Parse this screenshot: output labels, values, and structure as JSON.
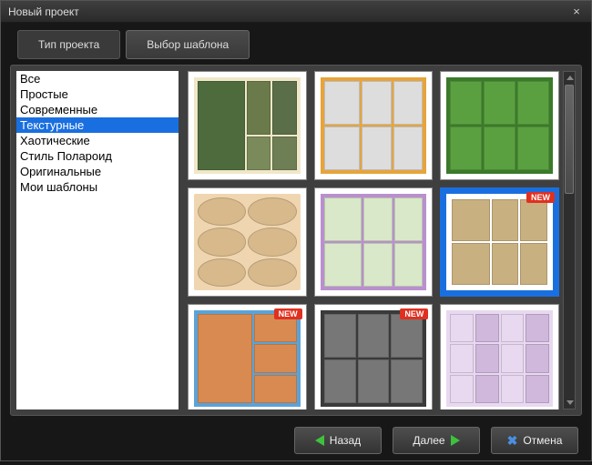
{
  "window": {
    "title": "Новый проект"
  },
  "tabs": [
    {
      "label": "Тип проекта",
      "active": false
    },
    {
      "label": "Выбор шаблона",
      "active": true
    }
  ],
  "categories": [
    "Все",
    "Простые",
    "Современные",
    "Текстурные",
    "Хаотические",
    "Стиль Полароид",
    "Оригинальные",
    "Мои шаблоны"
  ],
  "selected_category_index": 3,
  "badges": {
    "new": "NEW"
  },
  "templates": [
    {
      "id": "t1",
      "new": false,
      "selected": false
    },
    {
      "id": "t2",
      "new": false,
      "selected": false
    },
    {
      "id": "t3",
      "new": false,
      "selected": false
    },
    {
      "id": "t4",
      "new": false,
      "selected": false
    },
    {
      "id": "t5",
      "new": false,
      "selected": false
    },
    {
      "id": "t6",
      "new": true,
      "selected": true
    },
    {
      "id": "t7",
      "new": true,
      "selected": false
    },
    {
      "id": "t8",
      "new": true,
      "selected": false
    },
    {
      "id": "t9",
      "new": false,
      "selected": false
    }
  ],
  "buttons": {
    "back": "Назад",
    "next": "Далее",
    "cancel": "Отмена"
  }
}
